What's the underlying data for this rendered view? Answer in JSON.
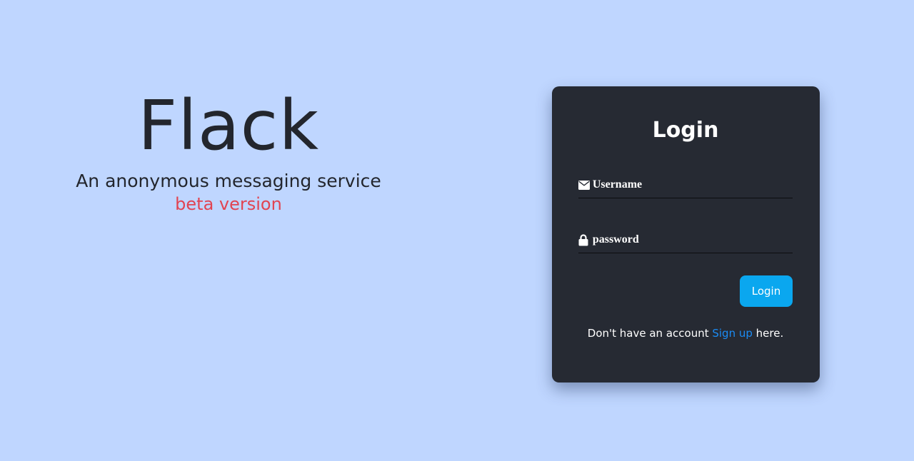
{
  "hero": {
    "title": "Flack",
    "tagline": "An anonymous messaging service",
    "badge": "beta version"
  },
  "login_card": {
    "title": "Login",
    "username": {
      "placeholder": "Username",
      "value": "",
      "icon": "envelope-icon"
    },
    "password": {
      "placeholder": "password",
      "value": "",
      "icon": "lock-icon"
    },
    "submit_label": "Login",
    "signup": {
      "prefix": "Don't have an account ",
      "link_label": "Sign up",
      "suffix": " here."
    }
  },
  "colors": {
    "background": "#bfd6ff",
    "card": "#262a33",
    "button": "#0aa7ef",
    "link": "#1b8cf5",
    "beta": "#e14452"
  }
}
